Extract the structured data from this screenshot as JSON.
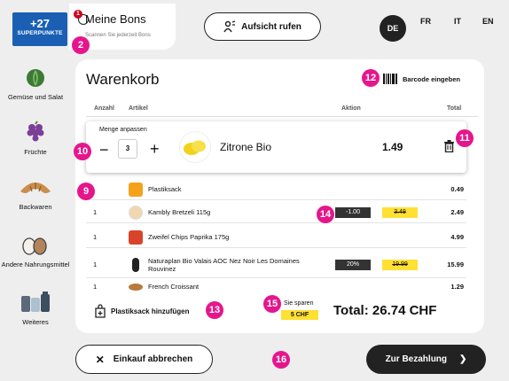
{
  "header": {
    "superpunkte_count": "+27",
    "superpunkte_label": "SUPERPUNKTE",
    "bons_badge": "1",
    "bons_title": "Meine Bons",
    "bons_subtitle": "Scannen Sie jederzeit Bons",
    "aufsicht_label": "Aufsicht rufen",
    "languages": [
      "DE",
      "FR",
      "IT",
      "EN"
    ]
  },
  "sidebar": {
    "items": [
      {
        "label": "Gemüse und Salat",
        "icon": "cabbage-icon"
      },
      {
        "label": "Früchte",
        "icon": "grapes-icon"
      },
      {
        "label": "Backwaren",
        "icon": "croissant-icon"
      },
      {
        "label": "Andere Nahrungsmittel",
        "icon": "eggs-icon"
      },
      {
        "label": "Weiteres",
        "icon": "household-icon"
      }
    ]
  },
  "cart": {
    "title": "Warenkorb",
    "barcode_label": "Barcode eingeben",
    "columns": {
      "anzahl": "Anzahl",
      "artikel": "Artikel",
      "aktion": "Aktion",
      "total": "Total"
    },
    "editor": {
      "heading": "Menge anpassen",
      "minus": "−",
      "qty": "3",
      "plus": "+",
      "name": "Zitrone Bio",
      "price": "1.49"
    },
    "items": [
      {
        "qty": "",
        "name": "Plastiksack",
        "discount": "",
        "old_price": "",
        "total": "0.49"
      },
      {
        "qty": "1",
        "name": "Kambly Bretzeli 115g",
        "discount": "-1.00",
        "old_price": "3.49",
        "total": "2.49"
      },
      {
        "qty": "1",
        "name": "Zweifel Chips Paprika 175g",
        "discount": "",
        "old_price": "",
        "total": "4.99"
      },
      {
        "qty": "1",
        "name": "Naturaplan Bio Valais AOC Nez Noir Les Domaines Rouvinez",
        "discount": "20%",
        "old_price": "19.99",
        "total": "15.99"
      },
      {
        "qty": "1",
        "name": "French Croissant",
        "discount": "",
        "old_price": "",
        "total": "1.29"
      }
    ],
    "add_bag_label": "Plastiksack hinzufügen",
    "savings_label": "Sie sparen",
    "savings_value": "5 CHF",
    "total_label": "Total: 26.74 CHF"
  },
  "footer": {
    "cancel_label": "Einkauf abbrechen",
    "pay_label": "Zur Bezahlung",
    "pay_arrow": "❯",
    "cancel_icon": "✕"
  },
  "markers": [
    "1",
    "2",
    "9",
    "10",
    "11",
    "12",
    "13",
    "14",
    "15",
    "16"
  ],
  "colors": {
    "accent": "#e5168c",
    "superpunkte": "#1a5fb4",
    "highlight": "#ffe033",
    "dark": "#222222"
  }
}
